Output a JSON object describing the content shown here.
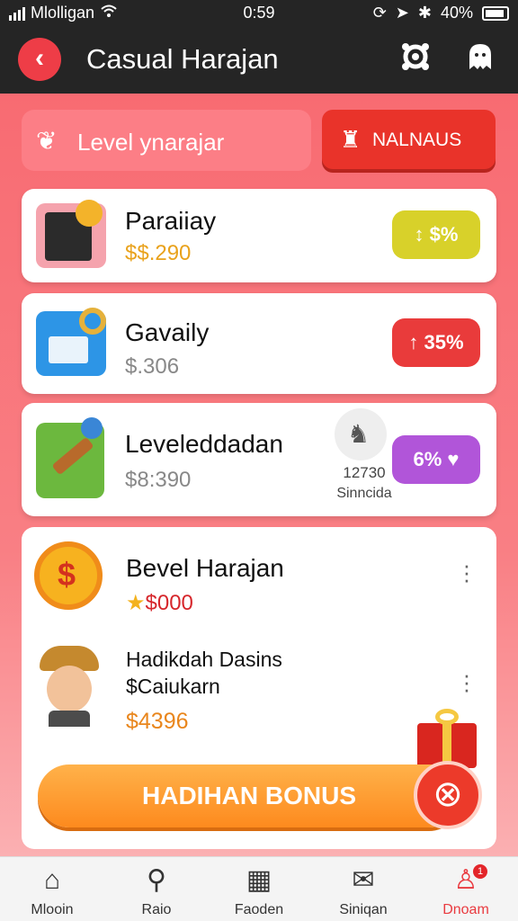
{
  "status_bar": {
    "carrier": "Mlolligan",
    "time": "0:59",
    "battery": "40%"
  },
  "header": {
    "title": "Casual Harajan",
    "icons": [
      "back-arrow-icon",
      "settings-gear-icon",
      "ghost-profile-icon"
    ]
  },
  "tabs": [
    {
      "label": "Level ynarajar",
      "icon": "heart-hands-icon"
    },
    {
      "label": "NALNAUS",
      "icon": "rocket-icon"
    }
  ],
  "items": [
    {
      "title": "Paraiiay",
      "price": "$$.290",
      "badge": "$%",
      "badge_color": "#d8d12a",
      "price_color": "#e9a21c"
    },
    {
      "title": "Gavaily",
      "price": "$.306",
      "badge": "35%",
      "badge_color": "#e93b3b",
      "price_color": "#888888"
    },
    {
      "title": "Leveleddadan",
      "price": "$8:390",
      "badge": "6%",
      "badge_color": "#b155d9",
      "price_color": "#888888",
      "side_number": "12730",
      "side_label": "Sinncida"
    }
  ],
  "feature": {
    "title": "Bevel Harajan",
    "price": "$000",
    "sub_title_1": "Hadikdah Dasins",
    "sub_title_2": "$Caiukarn",
    "sub_price": "$4396",
    "bonus_label": "HADIHAN BONUS"
  },
  "nav": [
    {
      "label": "Mlooin",
      "icon": "home-icon"
    },
    {
      "label": "Raio",
      "icon": "search-icon"
    },
    {
      "label": "Faoden",
      "icon": "calendar-icon"
    },
    {
      "label": "Siniqan",
      "icon": "mail-icon"
    },
    {
      "label": "Dnoam",
      "icon": "profile-icon",
      "badge": "1"
    }
  ],
  "colors": {
    "accent": "#ee3d47",
    "header_bg": "#252525",
    "bonus": "#fd8a1e"
  }
}
